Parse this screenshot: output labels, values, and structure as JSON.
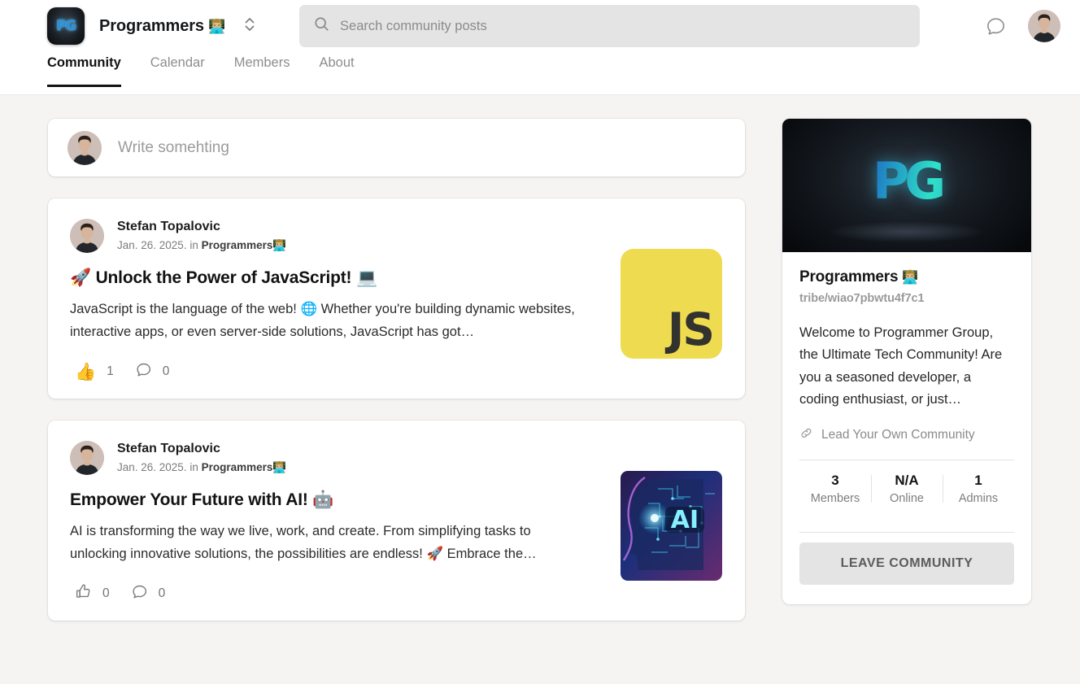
{
  "header": {
    "logo_text": "PG",
    "community_title": "Programmers",
    "community_emoji": "👨🏼‍💻",
    "switcher_icon": "unfold-vertical-icon",
    "search": {
      "placeholder": "Search community posts",
      "value": "",
      "icon": "search-icon"
    },
    "chat_icon": "chat-bubble-icon",
    "avatar_name": "user-avatar"
  },
  "tabs": [
    {
      "label": "Community",
      "active": true
    },
    {
      "label": "Calendar",
      "active": false
    },
    {
      "label": "Members",
      "active": false
    },
    {
      "label": "About",
      "active": false
    }
  ],
  "composer": {
    "placeholder": "Write somehting"
  },
  "posts": [
    {
      "author": "Stefan Topalovic",
      "date": "Jan. 26. 2025.",
      "in_label": "in",
      "community": "Programmers",
      "community_emoji": "👨🏼‍💻",
      "title_emoji_lead": "🚀",
      "title": "Unlock the Power of JavaScript!",
      "title_emoji_trail": "💻",
      "text_1": "JavaScript is the language of the web!",
      "text_emoji": "🌐",
      "text_2": "Whether you're building dynamic websites, interactive apps, or even server-side solutions, JavaScript has got…",
      "likes": "1",
      "comments": "0",
      "liked": true,
      "thumbnail": "javascript-logo",
      "thumb_label": "JS"
    },
    {
      "author": "Stefan Topalovic",
      "date": "Jan. 26. 2025.",
      "in_label": "in",
      "community": "Programmers",
      "community_emoji": "👨🏼‍💻",
      "title_emoji_lead": "",
      "title": "Empower Your Future with AI!",
      "title_emoji_trail": "🤖",
      "text_1": "AI is transforming the way we live, work, and create. From simplifying tasks to unlocking innovative solutions, the possibilities are endless!",
      "text_emoji": "🚀",
      "text_2": "Embrace the…",
      "likes": "0",
      "comments": "0",
      "liked": false,
      "thumbnail": "ai-head-image",
      "thumb_label": "AI"
    }
  ],
  "sidebar": {
    "banner_logo": "PG",
    "title": "Programmers",
    "title_emoji": "👨🏼‍💻",
    "slug": "tribe/wiao7pbwtu4f7c1",
    "description": "Welcome to Programmer Group, the Ultimate Tech Community! Are you a seasoned developer, a coding enthusiast, or just…",
    "link_label": "Lead Your Own Community",
    "link_icon": "link-icon",
    "stats": [
      {
        "value": "3",
        "label": "Members"
      },
      {
        "value": "N/A",
        "label": "Online"
      },
      {
        "value": "1",
        "label": "Admins"
      }
    ],
    "leave_button": "LEAVE COMMUNITY"
  },
  "colors": {
    "page_background": "#f5f4f2",
    "card_background": "#ffffff",
    "active_tab": "#121212",
    "muted_text": "#8d8d8d",
    "search_background": "#e4e4e4",
    "js_yellow": "#eedb50"
  }
}
